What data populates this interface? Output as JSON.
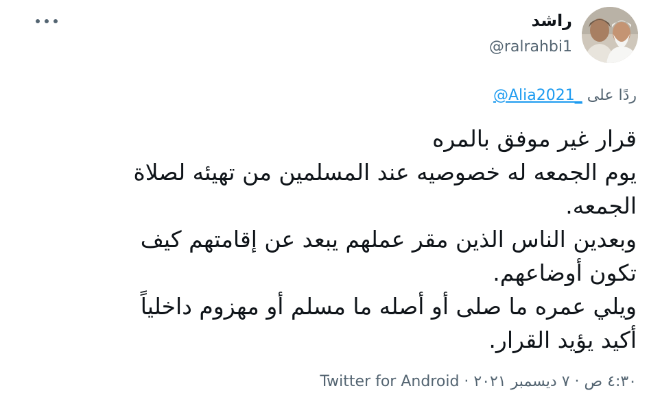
{
  "user": {
    "display_name": "راشد",
    "handle": "@ralrahbi1"
  },
  "menu": {
    "icon": "more-horizontal-icon"
  },
  "reply": {
    "prefix": "ردًا على",
    "mention": "@Alia2021_"
  },
  "tweet": {
    "lines": [
      "قرار غير موفق بالمره",
      "يوم الجمعه له خصوصيه عند المسلمين من تهيئه لصلاة",
      "الجمعه.",
      "وبعدين الناس الذين مقر عملهم يبعد عن إقامتهم كيف",
      "تكون أوضاعهم.",
      "ويلي عمره ما صلى أو أصله ما مسلم أو مهزوم داخلياً",
      "أكيد يؤيد القرار."
    ]
  },
  "meta": {
    "time": "٤:٣٠ ص",
    "date": "٧ ديسمبر ٢٠٢١",
    "separator": "·",
    "source": "Twitter for Android"
  },
  "colors": {
    "text": "#0f1419",
    "secondary": "#536471",
    "link": "#1d9bf0"
  }
}
